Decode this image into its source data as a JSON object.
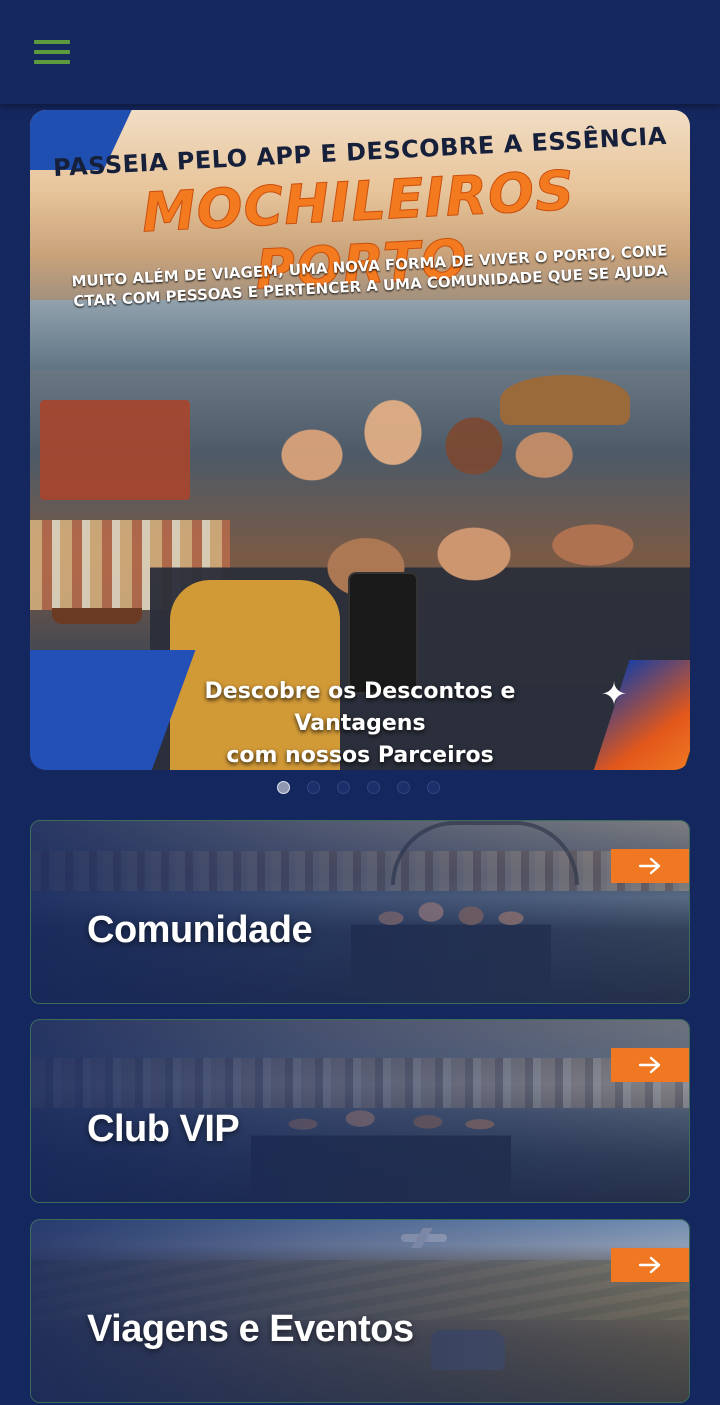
{
  "header": {
    "menu_icon": "hamburger-menu-icon",
    "menu_color": "#5c9c3c"
  },
  "banner": {
    "headline": "PASSEIA PELO APP E DESCOBRE A ESSÊNCIA",
    "title": "MOCHILEIROS PORTO",
    "subtitle_line1": "MUITO ALÉM DE VIAGEM, UMA NOVA FORMA DE VIVER O PORTO, CONE",
    "subtitle_line2": "CTAR COM PESSOAS E PERTENCER A UMA COMUNIDADE QUE SE AJUDA",
    "cta_line1": "Descobre os Descontos e Vantagens",
    "cta_line2": "com nossos Parceiros",
    "sparkle": "✦",
    "title_color": "#f37a1f"
  },
  "carousel": {
    "total": 6,
    "active": 1
  },
  "cards": [
    {
      "label": "Comunidade",
      "arrow_icon": "arrow-right-icon"
    },
    {
      "label": "Club VIP",
      "arrow_icon": "arrow-right-icon"
    },
    {
      "label": "Viagens e Eventos",
      "arrow_icon": "arrow-right-icon"
    }
  ],
  "colors": {
    "background": "#15275f",
    "accent": "#f07822"
  }
}
